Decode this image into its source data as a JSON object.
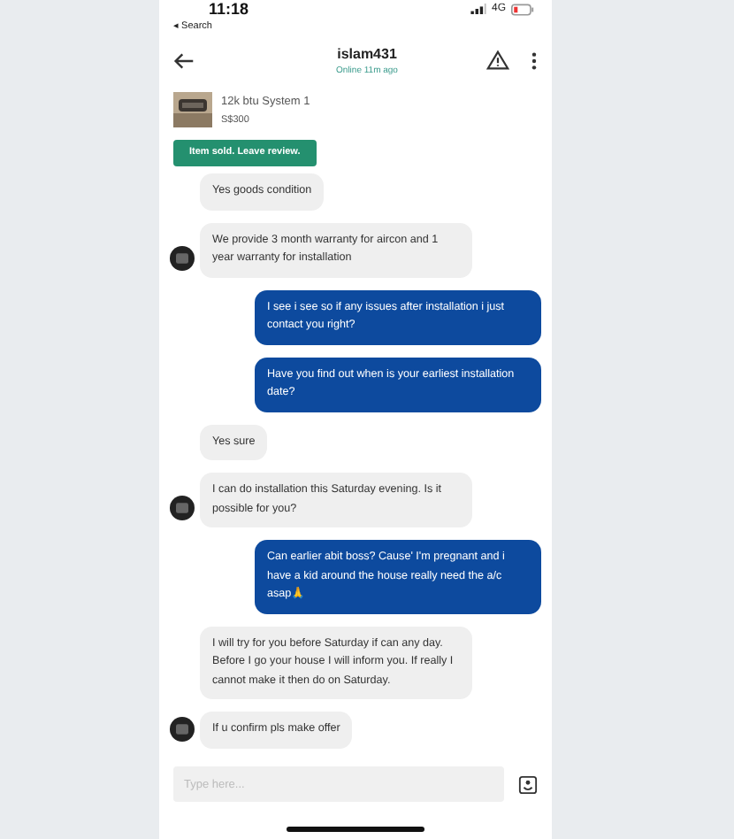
{
  "status_bar": {
    "time": "11:18",
    "back_label": "◂ Search",
    "network": "4G"
  },
  "header": {
    "title": "islam431",
    "subtitle": "Online 11m ago"
  },
  "listing": {
    "title": "12k btu System 1",
    "price": "S$300",
    "action": "Item sold. Leave review."
  },
  "messages": [
    {
      "kind": "received",
      "text": "Yes goods condition",
      "avatar": false
    },
    {
      "kind": "received",
      "text": "We provide 3 month warranty for aircon and 1 year warranty for installation",
      "avatar": true
    },
    {
      "kind": "sent",
      "text": "I see i see so if any issues after installation i just contact you right?",
      "avatar": false
    },
    {
      "kind": "sent",
      "text": "Have you find out when is your earliest installation date?",
      "avatar": false
    },
    {
      "kind": "received",
      "text": "Yes sure",
      "avatar": false
    },
    {
      "kind": "received",
      "text": "I can do installation this Saturday evening. Is it possible for you?",
      "avatar": true
    },
    {
      "kind": "sent",
      "text": "Can earlier abit boss? Cause' I'm pregnant and i have a kid around the house really need the a/c asap🙏",
      "avatar": false
    },
    {
      "kind": "received",
      "text": "I will try for you before Saturday if can any day. Before I go your house I will inform you. If really I cannot make it then do on Saturday.",
      "avatar": false
    },
    {
      "kind": "received",
      "text": "If u confirm pls make offer",
      "avatar": true
    }
  ],
  "composer": {
    "placeholder": "Type here..."
  }
}
